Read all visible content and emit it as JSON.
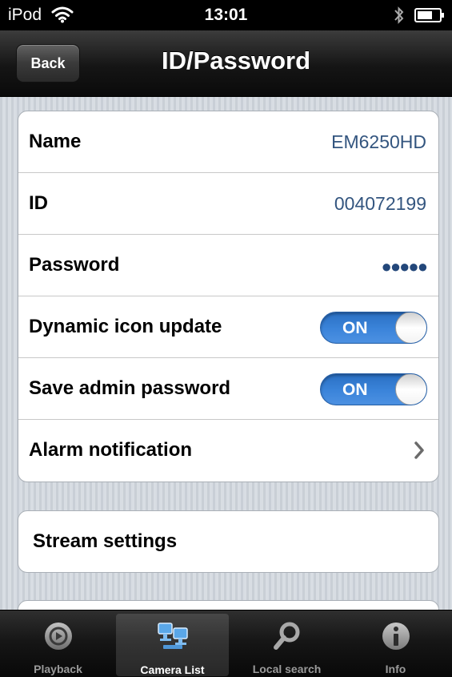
{
  "status_bar": {
    "carrier": "iPod",
    "time": "13:01"
  },
  "nav": {
    "back_label": "Back",
    "title": "ID/Password"
  },
  "settings": {
    "name": {
      "label": "Name",
      "value": "EM6250HD"
    },
    "id": {
      "label": "ID",
      "value": "004072199"
    },
    "password": {
      "label": "Password",
      "value": "●●●●●"
    },
    "dynamic_icon_update": {
      "label": "Dynamic icon update",
      "state": "ON"
    },
    "save_admin_password": {
      "label": "Save admin password",
      "state": "ON"
    },
    "alarm_notification": {
      "label": "Alarm notification"
    },
    "stream_settings": {
      "label": "Stream settings"
    }
  },
  "tabs": [
    {
      "label": "Playback",
      "icon": "playback-icon",
      "active": false
    },
    {
      "label": "Camera List",
      "icon": "camera-list-icon",
      "active": true
    },
    {
      "label": "Local search",
      "icon": "search-icon",
      "active": false
    },
    {
      "label": "Info",
      "icon": "info-icon",
      "active": false
    }
  ],
  "colors": {
    "value_text": "#33557f",
    "switch_on": "#3b84da",
    "nav_bar": "#151515"
  }
}
